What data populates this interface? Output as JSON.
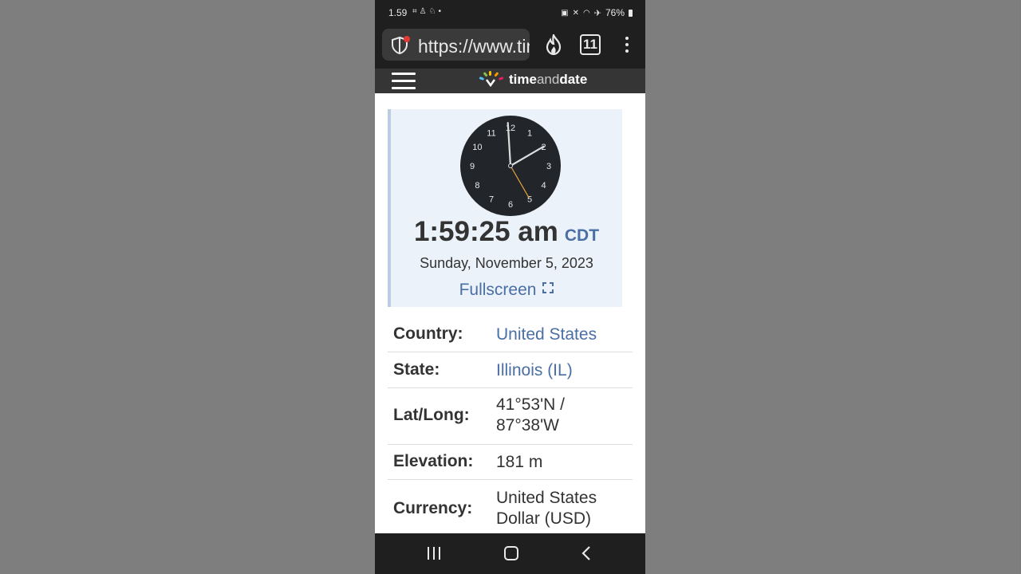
{
  "status_bar": {
    "time": "1.59",
    "battery": "76%",
    "icons": [
      "screenshot-icon",
      "snapchat-icon",
      "snapchat-icon",
      "notification-dot",
      "nfc-icon",
      "mute-icon",
      "wifi-icon",
      "airplane-icon",
      "battery-icon"
    ]
  },
  "browser": {
    "url": "https://www.timeanddate.com",
    "tab_count": "11",
    "icons": [
      "shield-icon",
      "flame-icon",
      "tabs-icon",
      "more-icon"
    ]
  },
  "site": {
    "logo_text_1": "time",
    "logo_text_2": "and",
    "logo_text_3": "date"
  },
  "clock": {
    "time": "1:59:25 am",
    "timezone": "CDT",
    "date": "Sunday, November 5, 2023",
    "fullscreen_label": "Fullscreen",
    "hour": 1,
    "minute": 59,
    "second": 25,
    "face_numbers": [
      "12",
      "1",
      "2",
      "3",
      "4",
      "5",
      "6",
      "7",
      "8",
      "9",
      "10",
      "11"
    ]
  },
  "info": {
    "country_label": "Country:",
    "country_value": "United States",
    "state_label": "State:",
    "state_value": "Illinois (IL)",
    "latlong_label": "Lat/Long:",
    "latlong_value_1": "41°53'N /",
    "latlong_value_2": "87°38'W",
    "elevation_label": "Elevation:",
    "elevation_value": "181 m",
    "currency_label": "Currency:",
    "currency_value_1": "United States",
    "currency_value_2": "Dollar (USD)"
  },
  "colors": {
    "link": "#4a6fa5",
    "panel_bg": "#ebf2f9",
    "clock_face": "#22262a",
    "second_hand": "#e8a33c",
    "chrome_dark": "#1f1f1f"
  }
}
